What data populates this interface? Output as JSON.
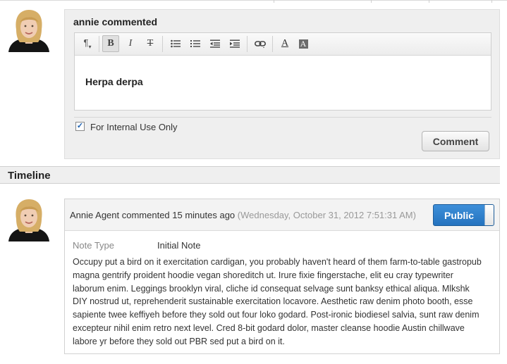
{
  "comment_form": {
    "title": "annie commented",
    "toolbar": {
      "paragraph": "paragraph-icon",
      "bold": "bold-icon",
      "italic": "italic-icon",
      "strikethrough": "strikethrough-icon",
      "bullet_list": "bullet-list-icon",
      "numbered_list": "numbered-list-icon",
      "outdent": "outdent-icon",
      "indent": "indent-icon",
      "link": "link-icon",
      "font_color": "font-color-icon",
      "highlight": "highlight-icon"
    },
    "editor_text": "Herpa derpa",
    "internal_checkbox": {
      "label": "For Internal Use Only",
      "checked": true
    },
    "submit_label": "Comment"
  },
  "timeline": {
    "title": "Timeline",
    "entries": [
      {
        "author_line": "Annie Agent commented 15 minutes ago",
        "date": "(Wednesday, October 31, 2012 7:51:31 AM)",
        "visibility_label": "Public",
        "field_label": "Note Type",
        "field_value": "Initial Note",
        "body": "Occupy put a bird on it exercitation cardigan, you probably haven't heard of them farm-to-table gastropub magna gentrify proident hoodie vegan shoreditch ut. Irure fixie fingerstache, elit eu cray typewriter laborum enim. Leggings brooklyn viral, cliche id consequat selvage sunt banksy ethical aliqua. Mlkshk DIY nostrud ut, reprehenderit sustainable exercitation locavore. Aesthetic raw denim photo booth, esse sapiente twee keffiyeh before they sold out four loko godard. Post-ironic biodiesel salvia, sunt raw denim excepteur nihil enim retro next level. Cred 8-bit godard dolor, master cleanse hoodie Austin chillwave labore yr before they sold out PBR sed put a bird on it."
      }
    ]
  },
  "colors": {
    "accent": "#2a7cc7",
    "panel": "#efefef",
    "muted_text": "#999999"
  }
}
